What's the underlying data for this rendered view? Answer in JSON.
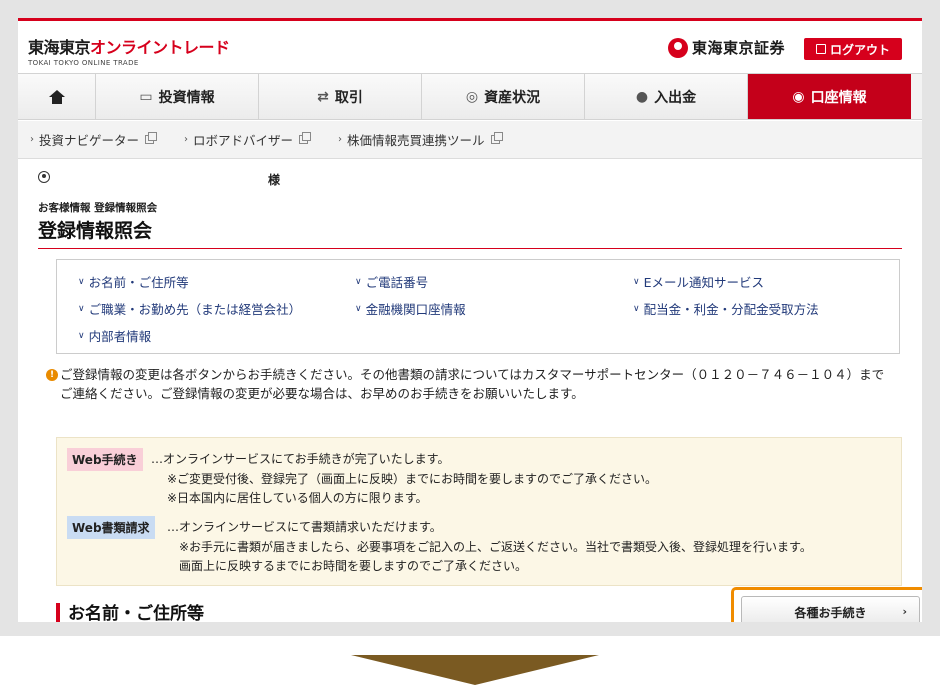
{
  "header": {
    "logo_main_dark": "東海東京",
    "logo_main_red": "オンライントレード",
    "logo_sub": "TOKAI TOKYO ONLINE TRADE",
    "brand": "東海東京証券",
    "logout": "ログアウト"
  },
  "nav": {
    "items": [
      {
        "label": "投資情報",
        "icon": "chart-icon"
      },
      {
        "label": "取引",
        "icon": "trade-icon"
      },
      {
        "label": "資産状況",
        "icon": "coins-icon"
      },
      {
        "label": "入出金",
        "icon": "bag-icon"
      },
      {
        "label": "口座情報",
        "icon": "person-icon"
      }
    ],
    "active_index": 4
  },
  "subnav": {
    "items": [
      {
        "label": "投資ナビゲーター"
      },
      {
        "label": "ロボアドバイザー"
      },
      {
        "label": "株価情報売買連携ツール"
      }
    ]
  },
  "user": {
    "suffix": "様"
  },
  "breadcrumb": "お客様情報 登録情報照会",
  "page_title": "登録情報照会",
  "links": [
    "お名前・ご住所等",
    "ご電話番号",
    "Eメール通知サービス",
    "ご職業・お勤め先（または経営会社）",
    "金融機関口座情報",
    "配当金・利金・分配金受取方法",
    "内部者情報"
  ],
  "notice": {
    "line1": "ご登録情報の変更は各ボタンからお手続きください。その他書類の請求についてはカスタマーサポートセンター（０１２０－７４６－１０４）まで",
    "line2": "ご連絡ください。ご登録情報の変更が必要な場合は、お早めのお手続きをお願いいたします。"
  },
  "info": {
    "web_tag": "Web手続き",
    "web_line1": "…オンラインサービスにてお手続きが完了いたします。",
    "web_line2": "※ご変更受付後、登録完了（画面上に反映）までにお時間を要しますのでご了承ください。",
    "web_line3": "※日本国内に居住している個人の方に限ります。",
    "doc_tag": "Web書類請求",
    "doc_line1": "…オンラインサービスにて書類請求いただけます。",
    "doc_line2": "※お手元に書類が届きましたら、必要事項をご記入の上、ご返送ください。当社で書類受入後、登録処理を行います。",
    "doc_line3": "画面上に反映するまでにお時間を要しますのでご了承ください。"
  },
  "section": {
    "title": "お名前・ご住所等",
    "button": "各種お手続き"
  },
  "colors": {
    "brand_red": "#d6001c",
    "highlight_orange": "#f08c00",
    "arrow_brown": "#7a5a22"
  }
}
